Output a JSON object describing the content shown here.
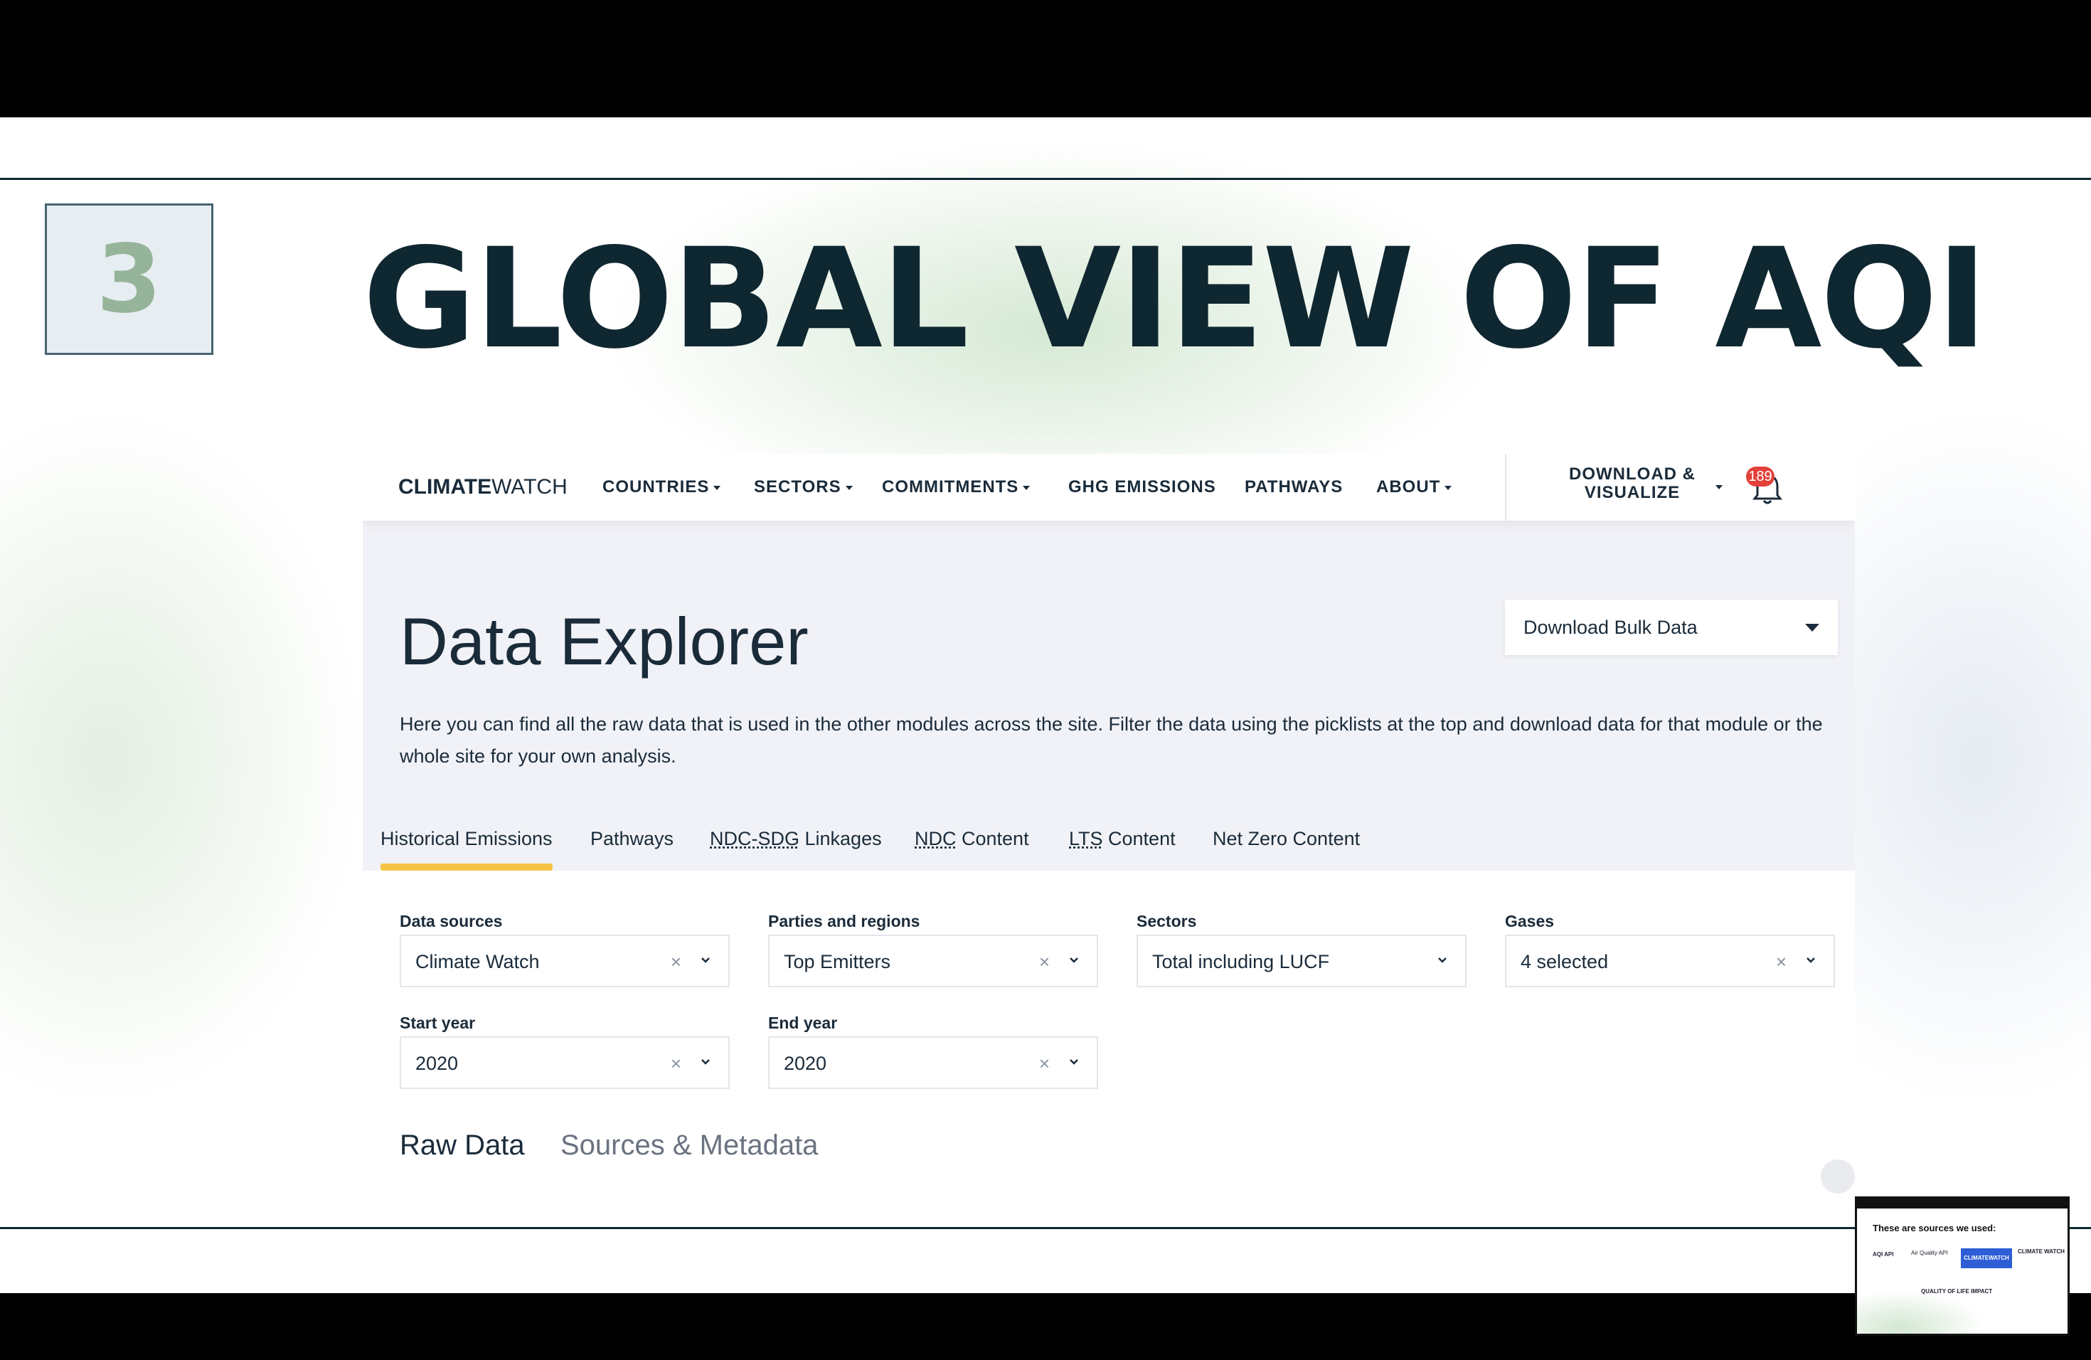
{
  "slide": {
    "number": "3",
    "title": "GLOBAL VIEW OF AQI"
  },
  "site": {
    "logo_bold": "CLIMATE",
    "logo_light": "WATCH",
    "nav": {
      "countries": "COUNTRIES",
      "sectors": "SECTORS",
      "commitments": "COMMITMENTS",
      "ghg_emissions": "GHG EMISSIONS",
      "pathways": "PATHWAYS",
      "about": "ABOUT",
      "download_line1": "DOWNLOAD &",
      "download_line2": "VISUALIZE",
      "notification_count": "189"
    },
    "download_bulk": "Download Bulk Data",
    "heading": "Data Explorer",
    "description": "Here you can find all the raw data that is used in the other modules across the site. Filter the data using the picklists at the top and download data for that module or the whole site for your own analysis.",
    "tabs": {
      "historical": "Historical Emissions",
      "pathways": "Pathways",
      "ndc_sdg_abbr": "NDC-SDG",
      "ndc_sdg_rest": " Linkages",
      "ndc_abbr": "NDC",
      "ndc_rest": " Content",
      "lts_abbr": "LTS",
      "lts_rest": " Content",
      "net_zero": "Net Zero Content"
    },
    "filters": {
      "data_sources": {
        "label": "Data sources",
        "value": "Climate Watch"
      },
      "parties": {
        "label": "Parties and regions",
        "value": "Top Emitters"
      },
      "sectors": {
        "label": "Sectors",
        "value": "Total including LUCF"
      },
      "gases": {
        "label": "Gases",
        "value": "4 selected"
      },
      "start_year": {
        "label": "Start year",
        "value": "2020"
      },
      "end_year": {
        "label": "End year",
        "value": "2020"
      },
      "clear_glyph": "×"
    },
    "subtabs": {
      "raw": "Raw Data",
      "sources": "Sources & Metadata"
    }
  },
  "thumbnail": {
    "title": "These are sources we used:",
    "aqi_api": "AQI API",
    "air_quality_api": "Air Quality API",
    "climate_watch_box": "CLIMATEWATCH",
    "climate_watch": "CLIMATE WATCH",
    "quality": "QUALITY OF LIFE IMPACT"
  },
  "colors": {
    "title": "#0f2730",
    "accent_tab": "#f6c344",
    "badge": "#e2403a"
  }
}
